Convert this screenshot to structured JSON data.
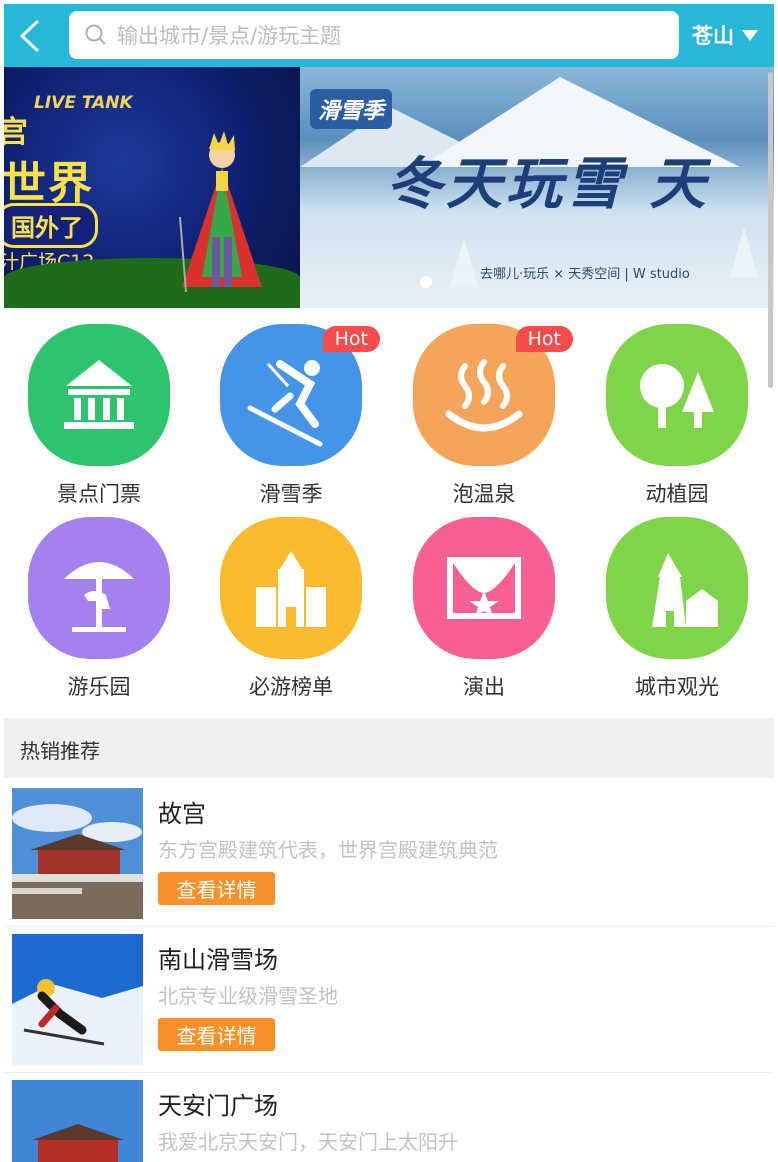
{
  "header": {
    "search_placeholder": "输出城市/景点/游玩主题",
    "city": "苍山"
  },
  "banner": {
    "slide1": {
      "logo": "LIVE TANK",
      "title_char": "宫",
      "title": "世界",
      "subtitle": "国外了",
      "location": "汁广场C12"
    },
    "slide2": {
      "brand": "滑雪季",
      "headline": "冬天玩雪 天",
      "sponsors": "去哪儿·玩乐  ×  天秀空间 | W studio"
    }
  },
  "categories": [
    {
      "label": "景点门票",
      "color": "#2ec46e",
      "icon": "pavilion-icon",
      "hot": ""
    },
    {
      "label": "滑雪季",
      "color": "#4495e8",
      "icon": "skier-icon",
      "hot": "Hot"
    },
    {
      "label": "泡温泉",
      "color": "#f5a55a",
      "icon": "hot-spring-icon",
      "hot": "Hot"
    },
    {
      "label": "动植园",
      "color": "#7fd44a",
      "icon": "trees-icon",
      "hot": ""
    },
    {
      "label": "游乐园",
      "color": "#a382f0",
      "icon": "carousel-icon",
      "hot": ""
    },
    {
      "label": "必游榜单",
      "color": "#f8bc2e",
      "icon": "castle-icon",
      "hot": ""
    },
    {
      "label": "演出",
      "color": "#f75e94",
      "icon": "stage-icon",
      "hot": ""
    },
    {
      "label": "城市观光",
      "color": "#7fd44a",
      "icon": "lighthouse-icon",
      "hot": ""
    }
  ],
  "section_title": "热销推荐",
  "items": [
    {
      "title": "故宫",
      "desc": "东方宫殿建筑代表，世界宫殿建筑典范",
      "button": "查看详情"
    },
    {
      "title": "南山滑雪场",
      "desc": "北京专业级滑雪圣地",
      "button": "查看详情"
    },
    {
      "title": "天安门广场",
      "desc": "我爱北京天安门，天安门上太阳升",
      "button": ""
    }
  ]
}
